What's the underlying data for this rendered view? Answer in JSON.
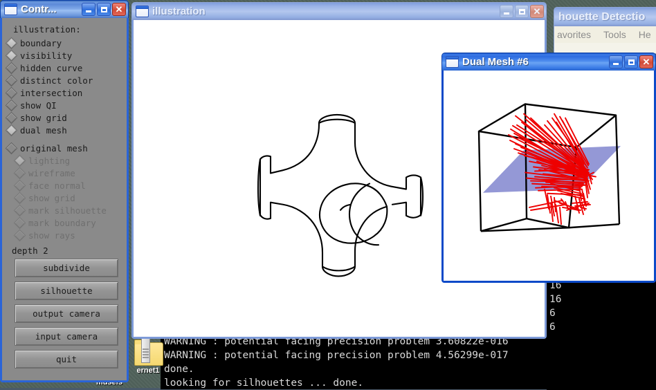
{
  "desktop": {
    "icons": [
      {
        "label": "ernet1",
        "icon": "folder-icon"
      },
      {
        "label": "museis",
        "icon": "folder-icon"
      },
      {
        "label": "ernet1",
        "icon": "folder-icon"
      }
    ]
  },
  "background_window": {
    "title": "houette Detectio",
    "menu": [
      "avorites",
      "Tools",
      "He"
    ]
  },
  "control_window": {
    "title": "Contr...",
    "titlebar_buttons": {
      "minimize": "minimize-icon",
      "maximize": "maximize-icon",
      "close": "close-icon"
    },
    "heading": "illustration:",
    "illustration_options": [
      {
        "label": "boundary",
        "checked": true
      },
      {
        "label": "visibility",
        "checked": true
      },
      {
        "label": "hidden curve",
        "checked": false
      },
      {
        "label": "distinct color",
        "checked": false
      },
      {
        "label": "intersection",
        "checked": false
      },
      {
        "label": "show QI",
        "checked": false
      },
      {
        "label": "show grid",
        "checked": false
      },
      {
        "label": "dual mesh",
        "checked": true
      }
    ],
    "mesh_group": {
      "label": "original mesh",
      "checked": false
    },
    "mesh_options": [
      {
        "label": "lighting",
        "checked": true,
        "disabled": true
      },
      {
        "label": "wireframe",
        "checked": false,
        "disabled": true
      },
      {
        "label": "face normal",
        "checked": false,
        "disabled": true
      },
      {
        "label": "show grid",
        "checked": false,
        "disabled": true
      },
      {
        "label": "mark silhouette",
        "checked": false,
        "disabled": true
      },
      {
        "label": "mark boundary",
        "checked": false,
        "disabled": true
      },
      {
        "label": "show rays",
        "checked": false,
        "disabled": true
      }
    ],
    "depth_label": "depth 2",
    "buttons": [
      {
        "label": "subdivide"
      },
      {
        "label": "silhouette"
      },
      {
        "label": "output camera"
      },
      {
        "label": "input camera"
      },
      {
        "label": "quit"
      }
    ]
  },
  "illustration_window": {
    "title": "illustration",
    "titlebar_buttons": {
      "minimize": "minimize-icon",
      "maximize": "maximize-icon",
      "close": "close-icon"
    }
  },
  "dual_mesh_window": {
    "title": "Dual Mesh #6",
    "titlebar_buttons": {
      "minimize": "minimize-icon",
      "maximize": "maximize-icon",
      "close": "close-icon"
    },
    "colors": {
      "edges": "#000000",
      "rays": "#ee0000",
      "plane": "#8e92d4"
    }
  },
  "terminal": {
    "lines": [
      "16",
      "16",
      "6",
      "6",
      "WARNING : potential facing precision problem 3.60822e-016",
      "WARNING : potential facing precision problem 4.56299e-017",
      "done.",
      "looking for silhouettes ... done."
    ],
    "right_column": [
      "16",
      "16",
      "6",
      "6"
    ],
    "main_lines": [
      "WARNING : potential facing precision problem 3.60822e-016",
      "WARNING : potential facing precision problem 4.56299e-017",
      "done.",
      "looking for silhouettes ... done."
    ]
  }
}
